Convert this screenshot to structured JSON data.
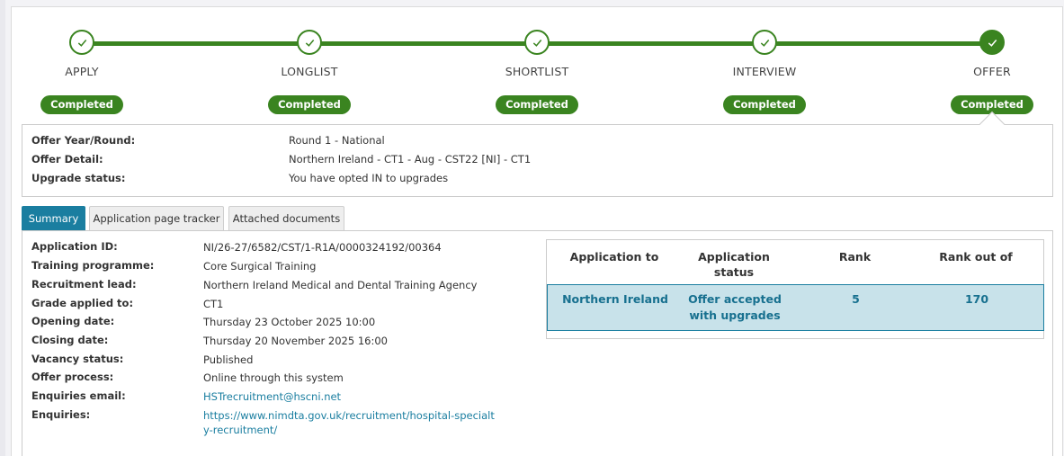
{
  "steps": [
    {
      "label": "APPLY",
      "status": "Completed"
    },
    {
      "label": "LONGLIST",
      "status": "Completed"
    },
    {
      "label": "SHORTLIST",
      "status": "Completed"
    },
    {
      "label": "INTERVIEW",
      "status": "Completed"
    },
    {
      "label": "OFFER",
      "status": "Completed"
    }
  ],
  "offer": {
    "rows": [
      {
        "key": "Offer Year/Round:",
        "value": "Round 1 - National"
      },
      {
        "key": "Offer Detail:",
        "value": "Northern Ireland - CT1 - Aug - CST22 [NI] - CT1"
      },
      {
        "key": "Upgrade status:",
        "value": "You have opted IN to upgrades"
      }
    ]
  },
  "tabs": [
    "Summary",
    "Application page tracker",
    "Attached documents"
  ],
  "active_tab": "Summary",
  "details": [
    {
      "key": "Application ID:",
      "value": "NI/26-27/6582/CST/1-R1A/0000324192/00364"
    },
    {
      "key": "Training programme:",
      "value": "Core Surgical Training"
    },
    {
      "key": "Recruitment lead:",
      "value": "Northern Ireland Medical and Dental Training Agency"
    },
    {
      "key": "Grade applied to:",
      "value": "CT1"
    },
    {
      "key": "Opening date:",
      "value": "Thursday 23 October 2025 10:00"
    },
    {
      "key": "Closing date:",
      "value": "Thursday 20 November 2025 16:00"
    },
    {
      "key": "Vacancy status:",
      "value": "Published"
    },
    {
      "key": "Offer process:",
      "value": "Online through this system"
    },
    {
      "key": "Enquiries email:",
      "value": "HSTrecruitment@hscni.net"
    },
    {
      "key": "Enquiries:",
      "value": "https://www.nimdta.gov.uk/recruitment/hospital-specialty-recruitment/"
    }
  ],
  "table": {
    "headers": [
      "Application to",
      "Application status",
      "Rank",
      "Rank out of"
    ],
    "rows": [
      [
        "Northern Ireland",
        "Offer accepted with upgrades",
        "5",
        "170"
      ]
    ]
  },
  "colors": {
    "accent_green": "#3a8420",
    "accent_blue": "#1a7ea0",
    "row_highlight": "#c8e2ea"
  },
  "icons": {
    "step": "check-icon"
  }
}
